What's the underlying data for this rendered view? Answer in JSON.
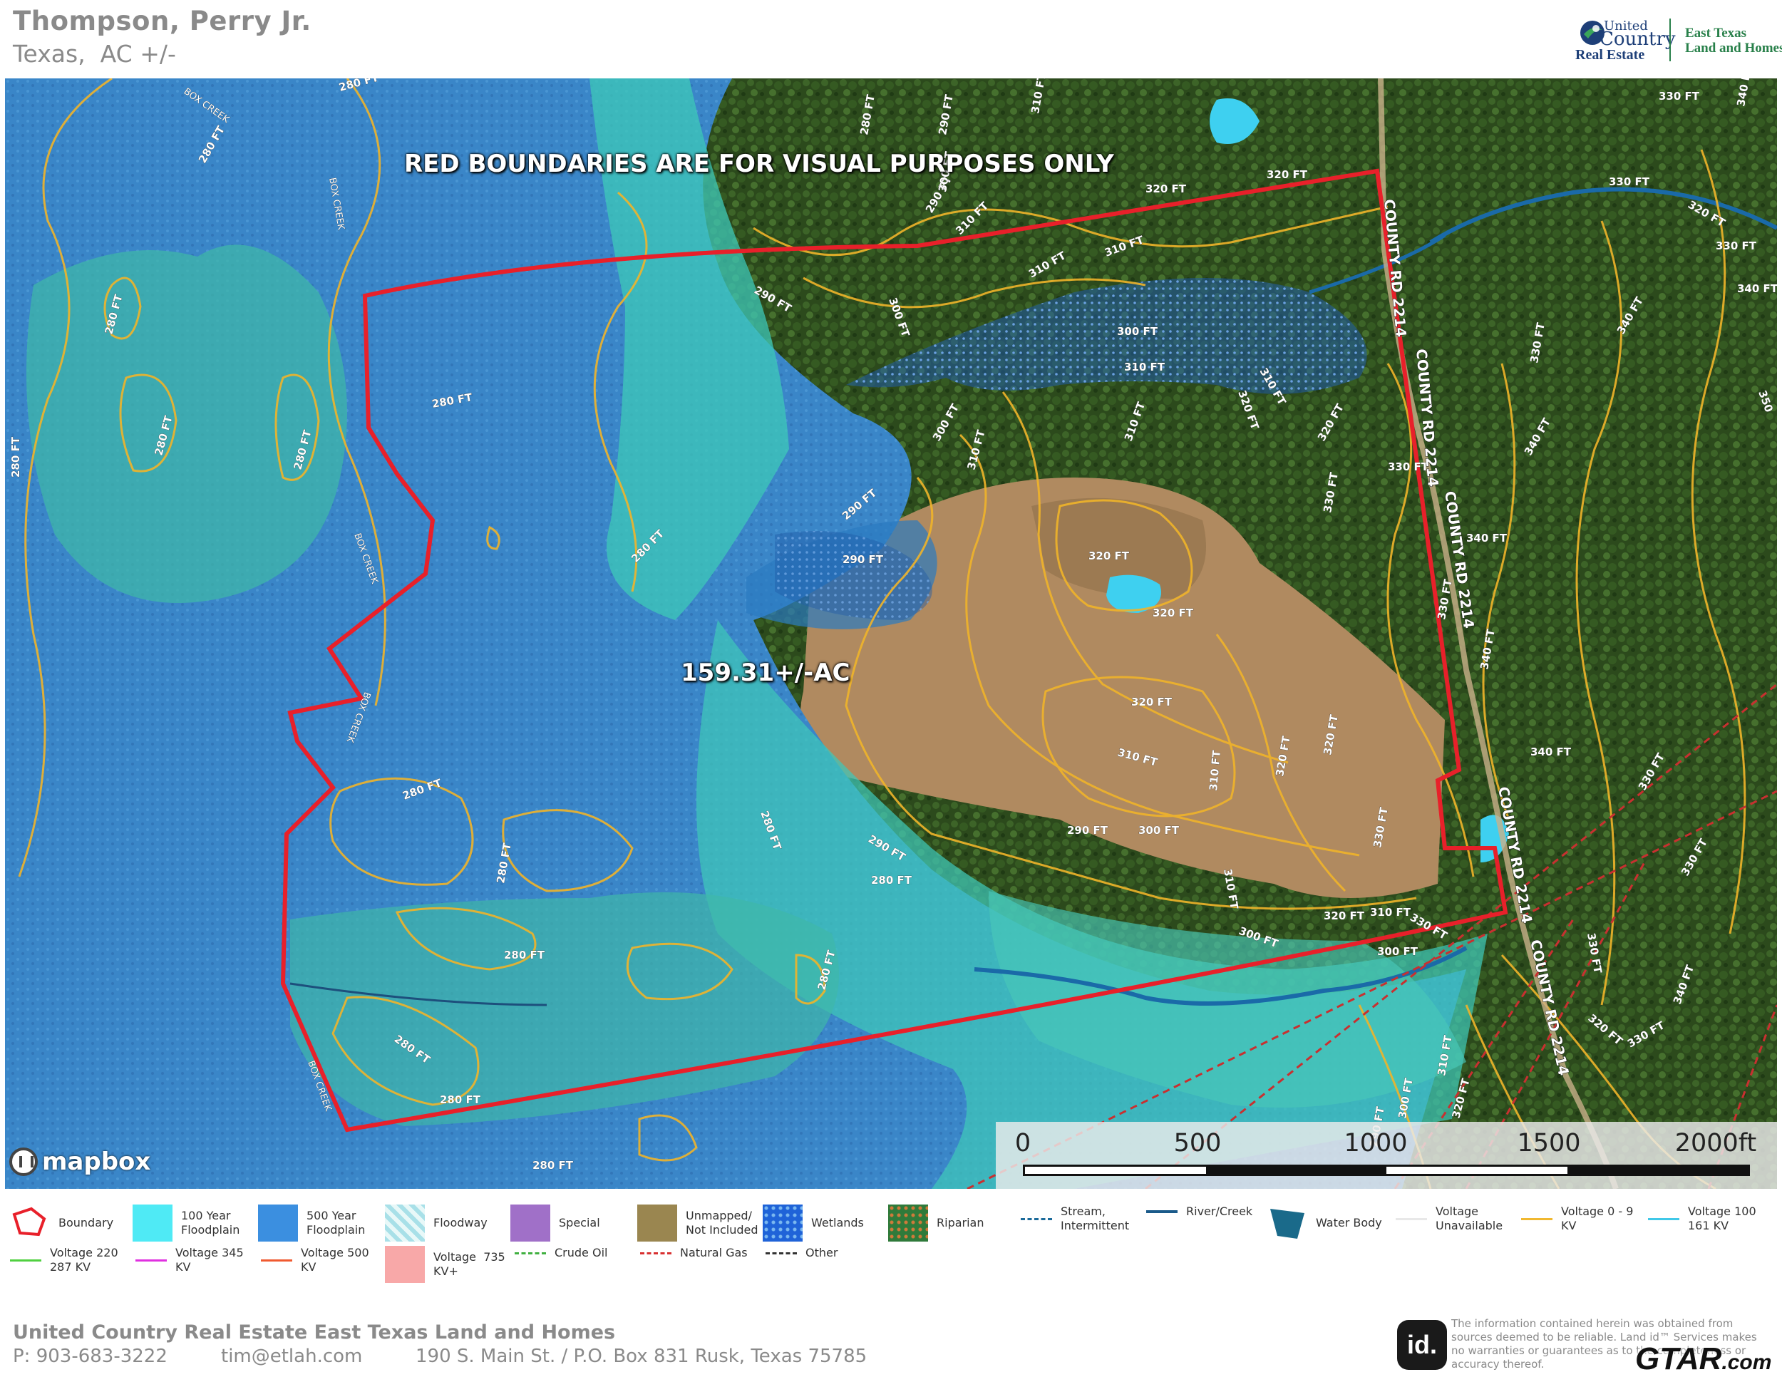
{
  "header": {
    "owner": "Thompson, Perry Jr.",
    "location": "Texas,  AC +/-",
    "logo": {
      "line1": "United",
      "line2": "Country",
      "line3": "Real Estate",
      "brand_line1": "East Texas",
      "brand_line2": "Land and Homes"
    }
  },
  "map": {
    "disclaimer": "RED BOUNDARIES ARE FOR VISUAL PURPOSES ONLY",
    "acreage": "159.31+/-AC",
    "attribution": "mapbox",
    "road_labels": [
      "COUNTY RD 2214",
      "COUNTY RD 2214",
      "COUNTY RD 2214",
      "COUNTY RD 2214",
      "COUNTY RD 2214"
    ],
    "creek_labels": [
      "BOX CREEK",
      "BOX CREEK",
      "BOX CREEK",
      "BOX CREEK",
      "BOX CREEK"
    ],
    "contour_labels": [
      "280 FT",
      "290 FT",
      "300 FT",
      "310 FT",
      "320 FT",
      "330 FT",
      "340 FT",
      "350"
    ],
    "scale": {
      "labels": [
        "0",
        "500",
        "1000",
        "1500",
        "2000ft"
      ]
    },
    "colors": {
      "boundary": "#e8202a",
      "floodplain_100": "#4fd8e0",
      "floodplain_500": "#3a8fd8",
      "contour": "#f0b42a",
      "water": "#4fd8f0"
    }
  },
  "legend": {
    "items": [
      {
        "label": "Boundary",
        "icon": "boundary-polygon-icon"
      },
      {
        "label": "100 Year\nFloodplain",
        "icon": "floodplain-100-swatch",
        "color": "#4feaf5"
      },
      {
        "label": "500 Year\nFloodplain",
        "icon": "floodplain-500-swatch",
        "color": "#3b8fe0"
      },
      {
        "label": "Floodway",
        "icon": "floodway-swatch",
        "color": "#a8e0e8"
      },
      {
        "label": "Special",
        "icon": "special-swatch",
        "color": "#a070c8"
      },
      {
        "label": "Unmapped/\nNot Included",
        "icon": "unmapped-swatch",
        "color": "#9a8650"
      },
      {
        "label": "Wetlands",
        "icon": "wetlands-swatch",
        "color": "#1f63d8"
      },
      {
        "label": "Riparian",
        "icon": "riparian-swatch",
        "color": "#2f7a3a"
      },
      {
        "label": "Stream,\nIntermittent",
        "icon": "stream-intermittent-line",
        "color": "#1a6a9a"
      },
      {
        "label": "River/Creek",
        "icon": "river-creek-line",
        "color": "#1a5a8a"
      },
      {
        "label": "Water Body",
        "icon": "water-body-swatch",
        "color": "#1a6a8a"
      },
      {
        "label": "Voltage\nUnavailable",
        "icon": "voltage-unavailable-line",
        "color": "#e8e8e8"
      },
      {
        "label": "Voltage 0 - 9\nKV",
        "icon": "voltage-0-9-line",
        "color": "#f0b830"
      },
      {
        "label": "Voltage 100\n161 KV",
        "icon": "voltage-100-161-line",
        "color": "#40c8e8"
      },
      {
        "label": "Voltage 220\n287 KV",
        "icon": "voltage-220-287-line",
        "color": "#50d040"
      },
      {
        "label": "Voltage 345\nKV",
        "icon": "voltage-345-line",
        "color": "#e030e0"
      },
      {
        "label": "Voltage 500\nKV",
        "icon": "voltage-500-line",
        "color": "#f05a30"
      },
      {
        "label": "Voltage  735\nKV+",
        "icon": "voltage-735-swatch",
        "color": "#f8a8a8"
      },
      {
        "label": "Crude Oil",
        "icon": "crude-oil-line",
        "color": "#40b040"
      },
      {
        "label": "Natural Gas",
        "icon": "natural-gas-line",
        "color": "#d83030"
      },
      {
        "label": "Other",
        "icon": "other-line",
        "color": "#333333"
      }
    ]
  },
  "footer": {
    "company": "United Country Real Estate East Texas Land and Homes",
    "phone": "P: 903-683-3222",
    "email": "tim@etlah.com",
    "address": "190 S. Main St. / P.O. Box 831 Rusk, Texas 75785",
    "id_logo": "id.",
    "notice": "The information contained herein was obtained from sources deemed to be reliable. Land id™ Services makes no warranties or guarantees as to the completeness or accuracy thereof.",
    "watermark": "GTAR",
    "watermark_tld": ".com"
  }
}
